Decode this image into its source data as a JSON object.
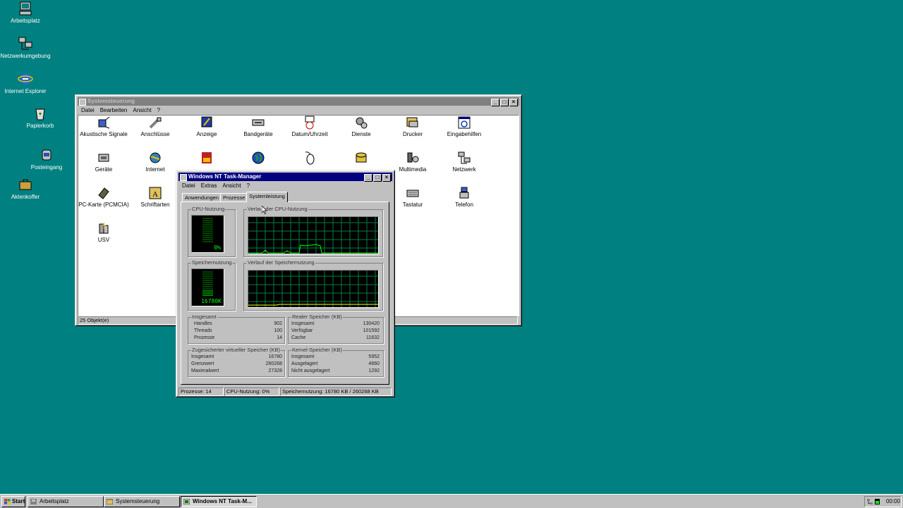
{
  "desktop": {
    "icons": [
      {
        "label": "Arbeitsplatz",
        "icon": "my-computer-icon"
      },
      {
        "label": "Netzwerkumgebung",
        "icon": "network-neighborhood-icon"
      },
      {
        "label": "Internet Explorer",
        "icon": "internet-explorer-icon"
      },
      {
        "label": "Papierkorb",
        "icon": "recycle-bin-icon"
      },
      {
        "label": "Posteingang",
        "icon": "inbox-icon"
      },
      {
        "label": "Aktenkoffer",
        "icon": "briefcase-icon"
      }
    ]
  },
  "control_panel": {
    "title": "Systemsteuerung",
    "menu": [
      "Datei",
      "Bearbeiten",
      "Ansicht",
      "?"
    ],
    "items": [
      {
        "label": "Akustische Signale",
        "icon": "sounds-icon"
      },
      {
        "label": "Anschlüsse",
        "icon": "ports-icon"
      },
      {
        "label": "Anzeige",
        "icon": "display-icon"
      },
      {
        "label": "Bandgeräte",
        "icon": "tape-devices-icon"
      },
      {
        "label": "Datum/Uhrzeit",
        "icon": "date-time-icon"
      },
      {
        "label": "Dienste",
        "icon": "services-icon"
      },
      {
        "label": "Drucker",
        "icon": "printers-icon"
      },
      {
        "label": "Eingabehilfen",
        "icon": "accessibility-icon"
      },
      {
        "label": "Geräte",
        "icon": "devices-icon"
      },
      {
        "label": "Internet",
        "icon": "internet-icon"
      },
      {
        "label": "",
        "icon": "msdtc-icon"
      },
      {
        "label": "",
        "icon": "globe-icon"
      },
      {
        "label": "",
        "icon": "mouse-icon"
      },
      {
        "label": "",
        "icon": "modem-icon"
      },
      {
        "label": "Multimedia",
        "icon": "multimedia-icon"
      },
      {
        "label": "Netzwerk",
        "icon": "network-icon"
      },
      {
        "label": "PC-Karte (PCMCIA)",
        "icon": "pc-card-icon"
      },
      {
        "label": "Schriftarten",
        "icon": "fonts-icon"
      },
      {
        "label": "Tastatur",
        "icon": "keyboard-icon"
      },
      {
        "label": "Telefon",
        "icon": "telephone-icon"
      },
      {
        "label": "USV",
        "icon": "ups-icon"
      }
    ],
    "status": "25 Objekt(e)"
  },
  "task_manager": {
    "title": "Windows NT Task-Manager",
    "menu": [
      "Datei",
      "Extras",
      "Ansicht",
      "?"
    ],
    "tabs": [
      "Anwendungen",
      "Prozesse",
      "Systemleistung"
    ],
    "active_tab": "Systemleistung",
    "cpu_usage_label": "CPU-Nutzung",
    "cpu_usage_value": "0%",
    "cpu_history_label": "Verlauf der CPU-Nutzung",
    "mem_usage_label": "Speichernutzung",
    "mem_usage_value": "16780K",
    "mem_history_label": "Verlauf der Speichernutzung",
    "totals": {
      "label": "Insgesamt",
      "rows": [
        {
          "label": "Handles",
          "value": "902"
        },
        {
          "label": "Threads",
          "value": "100"
        },
        {
          "label": "Prozesse",
          "value": "14"
        }
      ]
    },
    "physical": {
      "label": "Realer Speicher (KB)",
      "rows": [
        {
          "label": "Insgesamt",
          "value": "130420"
        },
        {
          "label": "Verfügbar",
          "value": "101592"
        },
        {
          "label": "Cache",
          "value": "11632"
        }
      ]
    },
    "commit": {
      "label": "Zugesicherter virtueller Speicher (KB)",
      "rows": [
        {
          "label": "Insgesamt",
          "value": "16780"
        },
        {
          "label": "Grenzwert",
          "value": "260268"
        },
        {
          "label": "Maximalwert",
          "value": "27328"
        }
      ]
    },
    "kernel": {
      "label": "Kernel-Speicher (KB)",
      "rows": [
        {
          "label": "Insgesamt",
          "value": "5952"
        },
        {
          "label": "Ausgelagert",
          "value": "4660"
        },
        {
          "label": "Nicht ausgelagert",
          "value": "1292"
        }
      ]
    },
    "status": [
      "Prozesse: 14",
      "CPU-Nutzung: 0%",
      "Speichernutzung: 16780 KB / 260268 KB"
    ]
  },
  "taskbar": {
    "start": "Start",
    "buttons": [
      "Arbeitsplatz",
      "Systemsteuerung",
      "Windows NT Task-M..."
    ],
    "active": "Windows NT Task-M...",
    "clock": "00:00"
  }
}
